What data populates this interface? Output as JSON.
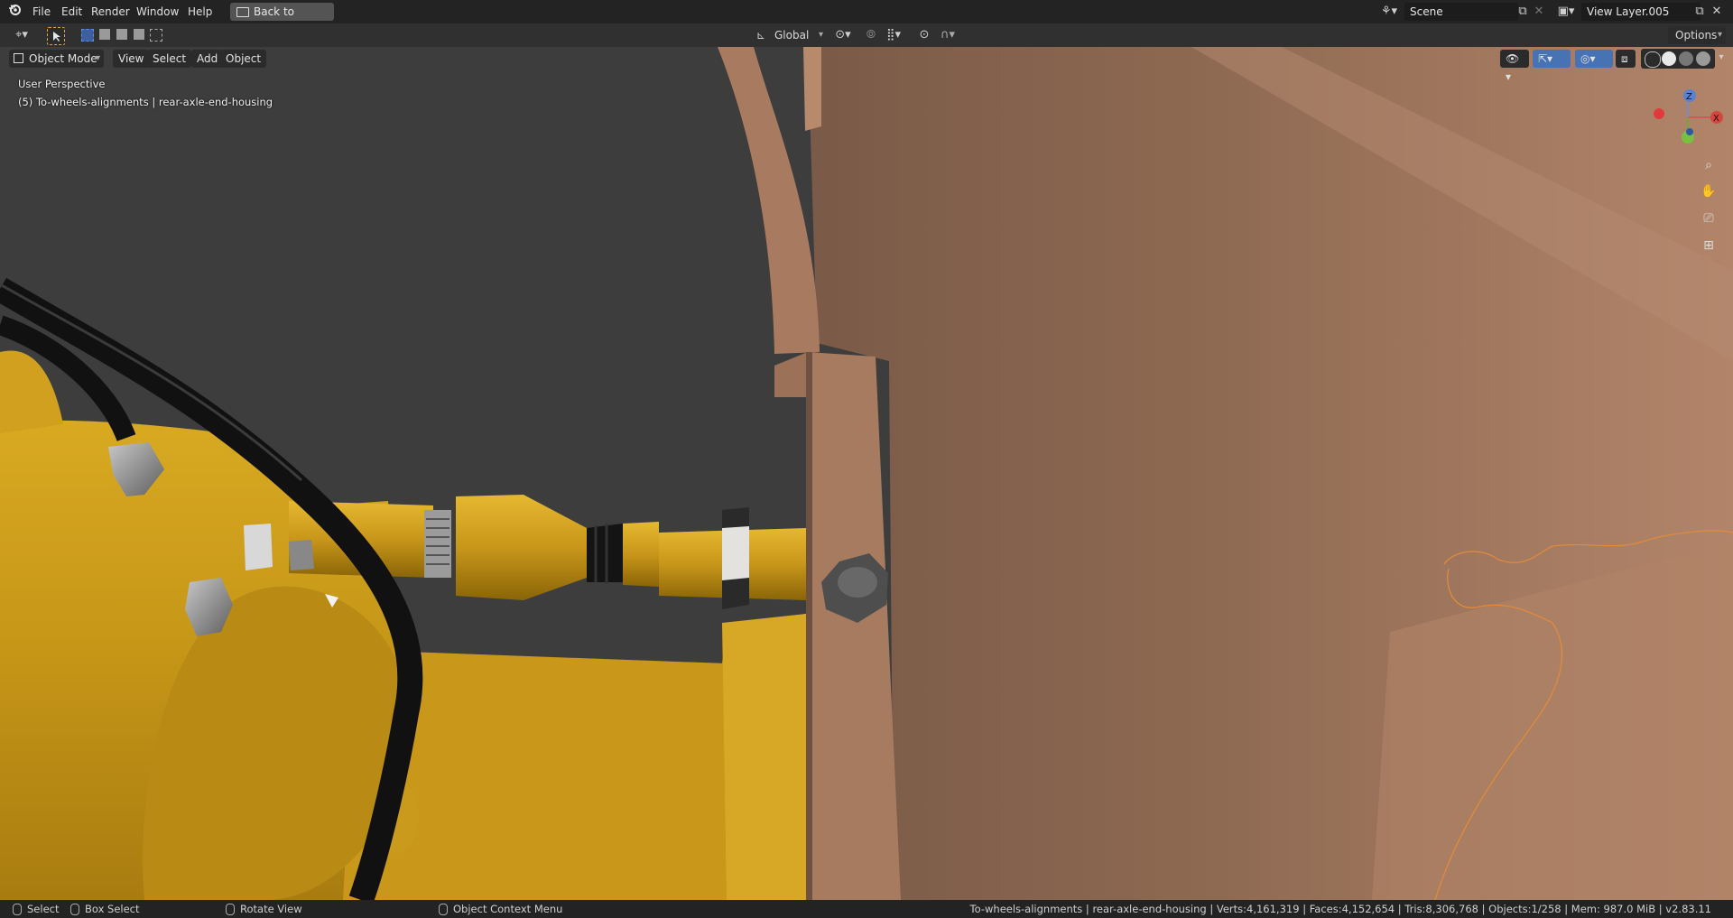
{
  "topbar": {
    "menus": [
      "File",
      "Edit",
      "Render",
      "Window",
      "Help"
    ],
    "back_button": "Back to Previous",
    "scene_name": "Scene",
    "view_layer": "View Layer.005"
  },
  "header": {
    "transform_orientation": "Global",
    "options_label": "Options"
  },
  "viewport_header": {
    "mode": "Object Mode",
    "menus": [
      "View",
      "Select",
      "Add",
      "Object"
    ]
  },
  "viewport": {
    "perspective": "User Perspective",
    "collection_info": "(5) To-wheels-alignments | rear-axle-end-housing"
  },
  "gizmo": {
    "z": "Z",
    "x": "X"
  },
  "statusbar": {
    "select": "Select",
    "box_select": "Box Select",
    "rotate_view": "Rotate View",
    "context_menu": "Object Context Menu",
    "stats": "To-wheels-alignments | rear-axle-end-housing | Verts:4,161,319 | Faces:4,152,654 | Tris:8,306,768 | Objects:1/258 | Mem: 987.0 MiB | v2.83.11"
  },
  "colors": {
    "yellow_part": "#d2a11a",
    "copper_part": "#a97a5d",
    "hose": "#161616",
    "background": "#3d3d3d",
    "selection_outline": "#e08a3c"
  }
}
